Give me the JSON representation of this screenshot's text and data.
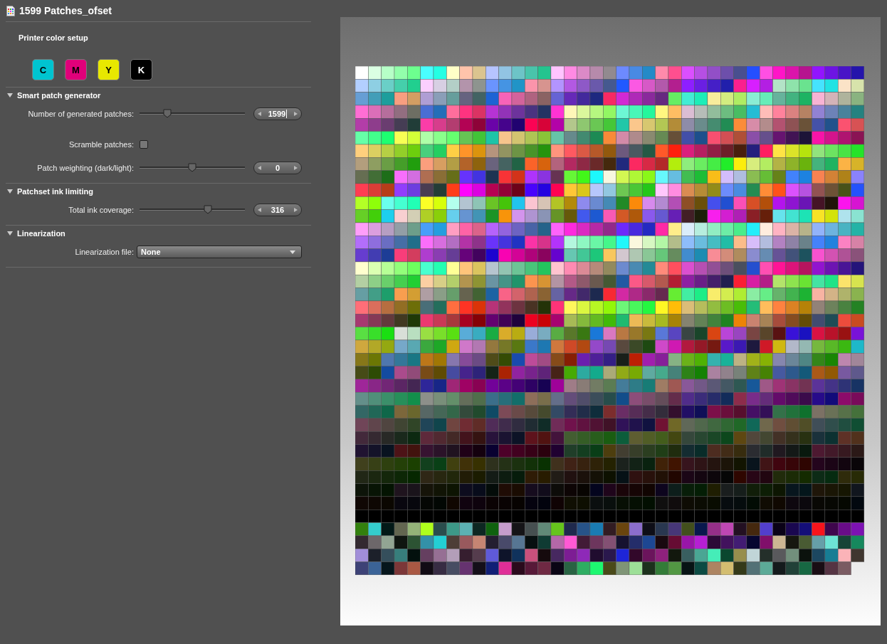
{
  "title": "1599 Patches_ofset",
  "printer_setup": {
    "heading": "Printer color setup",
    "inks": [
      {
        "label": "C",
        "color": "#00c4d0"
      },
      {
        "label": "M",
        "color": "#e0007a"
      },
      {
        "label": "Y",
        "color": "#e8e800"
      },
      {
        "label": "K",
        "color": "#000000"
      }
    ]
  },
  "sections": [
    {
      "title": "Smart patch generator",
      "expanded": true,
      "controls": [
        {
          "kind": "slider",
          "label": "Number of generated patches:",
          "level": 0.24,
          "value": "1599",
          "focused": true
        },
        {
          "kind": "checkbox",
          "label": "Scramble patches:",
          "checked": false
        },
        {
          "kind": "slider",
          "label": "Patch weighting (dark/light):",
          "level": 0.5,
          "value": "0",
          "focused": false
        }
      ]
    },
    {
      "title": "Patchset ink limiting",
      "expanded": true,
      "controls": [
        {
          "kind": "slider",
          "label": "Total ink coverage:",
          "level": 0.66,
          "value": "316",
          "focused": false
        }
      ]
    },
    {
      "title": "Linearization",
      "expanded": true,
      "controls": [
        {
          "kind": "dropdown",
          "label": "Linearization file:",
          "value": "None"
        }
      ]
    }
  ]
}
